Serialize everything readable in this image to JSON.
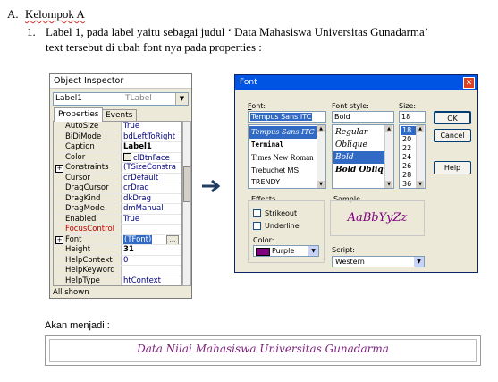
{
  "doc": {
    "section_marker": "A.",
    "section_title": "Kelompok  A",
    "item_number": "1.",
    "item_line1": "Label 1, pada label  yaitu sebagai judul ‘ Data Mahasiswa Universitas Gunadarma’",
    "item_line2": "text tersebut di ubah font nya pada properties :",
    "result_label": "Akan menjadi :",
    "result_text": "Data Nilai Mahasiswa Universitas Gunadarma"
  },
  "object_inspector": {
    "title": "Object Inspector",
    "component_name": "Label1",
    "component_class": "TLabel",
    "tabs": [
      "Properties",
      "Events"
    ],
    "footer": "All shown",
    "properties": [
      {
        "key": "AutoSize",
        "value": "True"
      },
      {
        "key": "BiDiMode",
        "value": "bdLeftToRight"
      },
      {
        "key": "Caption",
        "value": "Label1"
      },
      {
        "key": "Color",
        "value": "clBtnFace"
      },
      {
        "key": "Constraints",
        "value": "(TSizeConstra"
      },
      {
        "key": "Cursor",
        "value": "crDefault"
      },
      {
        "key": "DragCursor",
        "value": "crDrag"
      },
      {
        "key": "DragKind",
        "value": "dkDrag"
      },
      {
        "key": "DragMode",
        "value": "dmManual"
      },
      {
        "key": "Enabled",
        "value": "True"
      },
      {
        "key": "FocusControl",
        "value": ""
      },
      {
        "key": "Font",
        "value": "(TFont)"
      },
      {
        "key": "Height",
        "value": "31"
      },
      {
        "key": "HelpContext",
        "value": "0"
      },
      {
        "key": "HelpKeyword",
        "value": ""
      },
      {
        "key": "HelpType",
        "value": "htContext"
      }
    ]
  },
  "font_dialog": {
    "title": "Font",
    "font_label": "Font:",
    "font_value": "Tempus Sans ITC",
    "font_list": [
      "Tempus Sans ITC",
      "Terminal",
      "Times New Roman",
      "Trebuchet MS",
      "TRENDY"
    ],
    "style_label": "Font style:",
    "style_value": "Bold",
    "style_list": [
      "Regular",
      "Oblique",
      "Bold",
      "Bold Oblique"
    ],
    "size_label": "Size:",
    "size_value": "18",
    "size_list": [
      "18",
      "20",
      "22",
      "24",
      "26",
      "28",
      "36"
    ],
    "ok_label": "OK",
    "cancel_label": "Cancel",
    "help_label": "Help",
    "effects_label": "Effects",
    "strikeout_label": "Strikeout",
    "underline_label": "Underline",
    "color_label": "Color:",
    "color_value": "Purple",
    "sample_label": "Sample",
    "sample_text": "AaBbYyZz",
    "script_label": "Script:",
    "script_value": "Western"
  },
  "colors": {
    "accent_purple": "#7a1f7a",
    "selection_blue": "#316ac5",
    "titlebar_blue": "#0054e3"
  }
}
